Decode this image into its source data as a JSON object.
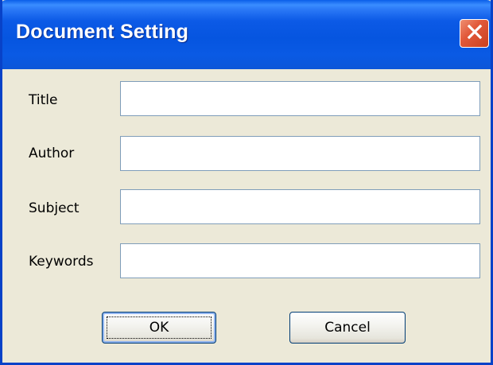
{
  "window": {
    "title": "Document Setting"
  },
  "form": {
    "fields": [
      {
        "label": "Title",
        "value": ""
      },
      {
        "label": "Author",
        "value": ""
      },
      {
        "label": "Subject",
        "value": ""
      },
      {
        "label": "Keywords",
        "value": ""
      }
    ]
  },
  "buttons": {
    "ok_label": "OK",
    "cancel_label": "Cancel"
  },
  "colors": {
    "titlebar": "#0655e0",
    "close_button": "#e2593a",
    "dialog_background": "#ece9d8",
    "field_border": "#7f9db9"
  },
  "icons": {
    "close": "close-icon"
  }
}
